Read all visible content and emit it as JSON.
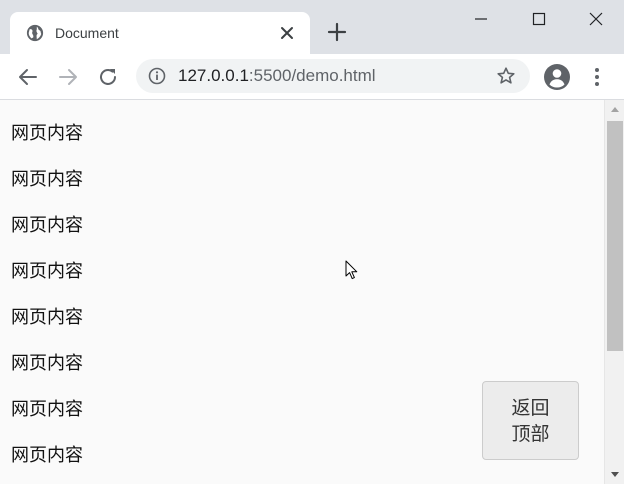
{
  "window": {
    "tab": {
      "title": "Document",
      "favicon": "globe-icon",
      "close_icon": "close-icon"
    },
    "new_tab_icon": "plus-icon",
    "controls": [
      "minimize-icon",
      "maximize-icon",
      "close-icon"
    ]
  },
  "toolbar": {
    "back_icon": "arrow-left-icon",
    "forward_icon": "arrow-right-icon",
    "reload_icon": "reload-icon",
    "address": {
      "info_icon": "info-icon",
      "host": "127.0.0.1",
      "path": ":5500/demo.html",
      "bookmark_icon": "star-icon"
    },
    "profile_icon": "account-icon",
    "menu_icon": "more-vert-icon"
  },
  "page": {
    "lines": [
      "网页内容",
      "网页内容",
      "网页内容",
      "网页内容",
      "网页内容",
      "网页内容",
      "网页内容",
      "网页内容"
    ],
    "back_to_top": {
      "line1": "返回",
      "line2": "顶部"
    }
  },
  "scrollbar": {
    "position": 0,
    "visible_fraction": 0.6
  },
  "colors": {
    "tabstrip": "#dee1e6",
    "toolbar": "#ffffff",
    "page_bg": "#fafafa",
    "text": "#111111"
  }
}
